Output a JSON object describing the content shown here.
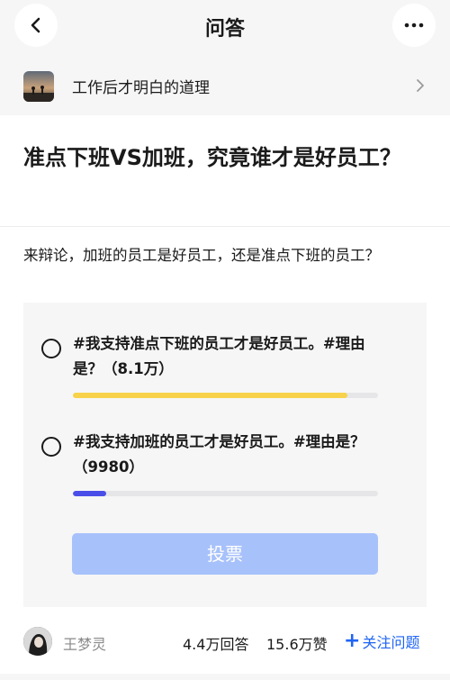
{
  "header": {
    "title": "问答",
    "back_icon": "back-arrow-icon",
    "more_icon": "more-dots-icon"
  },
  "topic": {
    "label": "工作后才明白的道理"
  },
  "question": {
    "title": "准点下班VS加班，究竟谁才是好员工？",
    "description": "来辩论，加班的员工是好员工，还是准点下班的员工？"
  },
  "poll": {
    "options": [
      {
        "label": "#我支持准点下班的员工才是好员工。#理由是？（8.1万）",
        "fraction": 0.9,
        "color": "#f7d24a"
      },
      {
        "label": "#我支持加班的员工才是好员工。#理由是？（9980）",
        "fraction": 0.11,
        "color": "#4a4ee8"
      }
    ],
    "vote_label": "投票"
  },
  "footer": {
    "author": "王梦灵",
    "answers": "4.4万回答",
    "likes": "15.6万赞",
    "follow_label": "关注问题"
  }
}
